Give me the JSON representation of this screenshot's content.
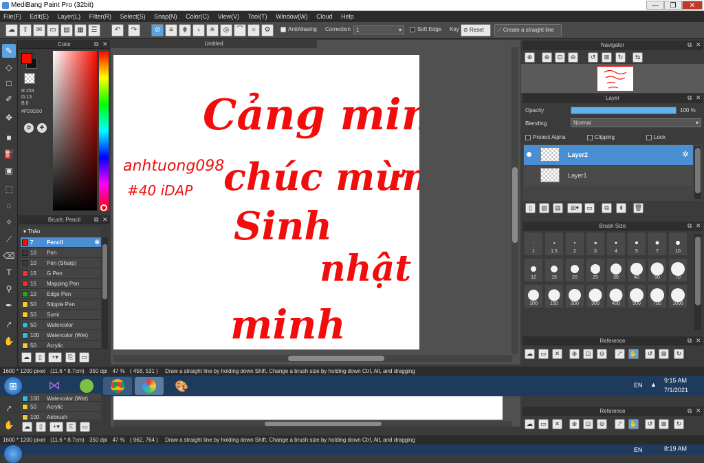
{
  "window": {
    "title": "MediBang Paint Pro (32bit)",
    "minimize": "—",
    "restore": "❐",
    "close": "✕"
  },
  "menu": [
    "File(F)",
    "Edit(E)",
    "Layer(L)",
    "Filter(R)",
    "Select(S)",
    "Snap(N)",
    "Color(C)",
    "View(V)",
    "Tool(T)",
    "Window(W)",
    "Cloud",
    "Help"
  ],
  "toolbar": {
    "antialiasing": "AntiAliasing",
    "correction_label": "Correction",
    "correction_value": "1",
    "soft_edge": "Soft Edge",
    "key": "Key",
    "reset": "Reset",
    "straight_line": "Create a straight line"
  },
  "color_panel": {
    "title": "Color",
    "r": "R:253",
    "g": "G:13",
    "b": "B:0",
    "hex": "#FD0D00",
    "primary": "#fd0d00"
  },
  "brush_panel": {
    "title": "Brush: Pencil",
    "group": "Thảo",
    "items": [
      {
        "size": "7",
        "name": "Pencil",
        "color": "#3a3a3a"
      },
      {
        "size": "10",
        "name": "Pen",
        "color": "#3a3a3a"
      },
      {
        "size": "10",
        "name": "Pen (Sharp)",
        "color": "#3a3a3a"
      },
      {
        "size": "15",
        "name": "G Pen",
        "color": "#e33"
      },
      {
        "size": "15",
        "name": "Mapping Pen",
        "color": "#e33"
      },
      {
        "size": "10",
        "name": "Edge Pen",
        "color": "#2a2"
      },
      {
        "size": "50",
        "name": "Stipple Pen",
        "color": "#ec3"
      },
      {
        "size": "50",
        "name": "Sumi",
        "color": "#ec3"
      },
      {
        "size": "50",
        "name": "Watercolor",
        "color": "#3bd"
      },
      {
        "size": "100",
        "name": "Watercolor (Wet)",
        "color": "#3bd"
      },
      {
        "size": "50",
        "name": "Acrylic",
        "color": "#ec3"
      }
    ]
  },
  "document": {
    "tab": "Untitled"
  },
  "canvas_text": {
    "line1": "Cảng minh",
    "line2": "chúc mừng",
    "line3": "Sinh",
    "line4": "nhật",
    "line5": "minh",
    "signature1": "anhtuong098",
    "signature2": "#40 iDAP"
  },
  "navigator": {
    "title": "Navigator"
  },
  "layer_panel": {
    "title": "Layer",
    "opacity_label": "Opacity",
    "opacity_value": "100 %",
    "opacity_level": 1.0,
    "blending_label": "Blending",
    "blending_value": "Normal",
    "protect_alpha": "Protect Alpha",
    "clipping": "Clipping",
    "lock": "Lock",
    "layers": [
      {
        "name": "Layer2"
      },
      {
        "name": "Layer1"
      }
    ]
  },
  "brush_size_panel": {
    "title": "Brush Size",
    "sizes": [
      "1",
      "1.5",
      "2",
      "3",
      "4",
      "5",
      "7",
      "10",
      "12",
      "15",
      "20",
      "25",
      "30",
      "40",
      "50",
      "70",
      "100",
      "150",
      "200",
      "300",
      "400",
      "500",
      "700",
      "1000"
    ]
  },
  "reference_panel": {
    "title": "Reference"
  },
  "status": {
    "pixel": "1600 * 1200 pixel",
    "cm": "(11.6 * 8.7cm)",
    "dpi": "350 dpi",
    "zoom": "47 %",
    "coords": "( 458, 531 )",
    "hint": "Draw a straight line by holding down Shift, Change a brush size by holding down Ctrl, Alt, and dragging"
  },
  "taskbar": {
    "lang": "EN",
    "time": "9:15 AM",
    "date": "7/1/2021"
  },
  "ghost": {
    "brush_items": [
      {
        "size": "100",
        "name": "Watercolor (Wet)"
      },
      {
        "size": "50",
        "name": "Acrylic"
      },
      {
        "size": "100",
        "name": "Airbrush"
      }
    ],
    "reference": "Reference",
    "pixel": "1600 * 1200 pixel",
    "cm": "(11.6 * 8.7cm)",
    "dpi": "350 dpi",
    "zoom": "47 %",
    "coords": "( 962, 764 )",
    "hint": "Draw a straight line by holding down Shift, Change a brush size by holding down Ctrl, Alt, and dragging",
    "lang": "EN",
    "time": "8:19 AM"
  }
}
